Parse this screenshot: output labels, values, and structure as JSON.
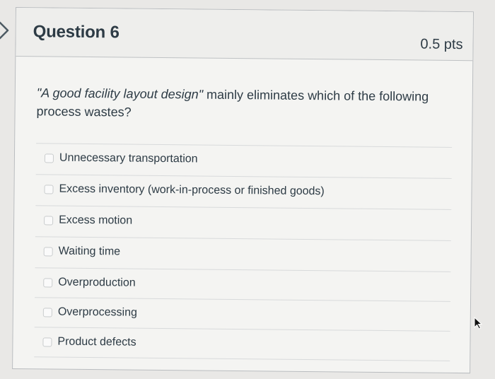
{
  "question": {
    "title": "Question 6",
    "points": "0.5 pts",
    "text_quoted": "\"A good facility layout design\"",
    "text_rest": " mainly eliminates which of the following process wastes?"
  },
  "answers": [
    {
      "label": "Unnecessary transportation",
      "selected": false
    },
    {
      "label": "Excess inventory (work-in-process or finished goods)",
      "selected": false
    },
    {
      "label": "Excess motion",
      "selected": false
    },
    {
      "label": "Waiting time",
      "selected": false
    },
    {
      "label": "Overproduction",
      "selected": false
    },
    {
      "label": "Overprocessing",
      "selected": false
    },
    {
      "label": "Product defects",
      "selected": false
    }
  ],
  "icons": {
    "nav": "chevron-right-icon",
    "pointer": "mouse-pointer-icon"
  },
  "colors": {
    "text": "#2d3b45",
    "border": "#b9bcbf",
    "header_background": "#eeeeec",
    "card_background": "#f4f4f2"
  }
}
